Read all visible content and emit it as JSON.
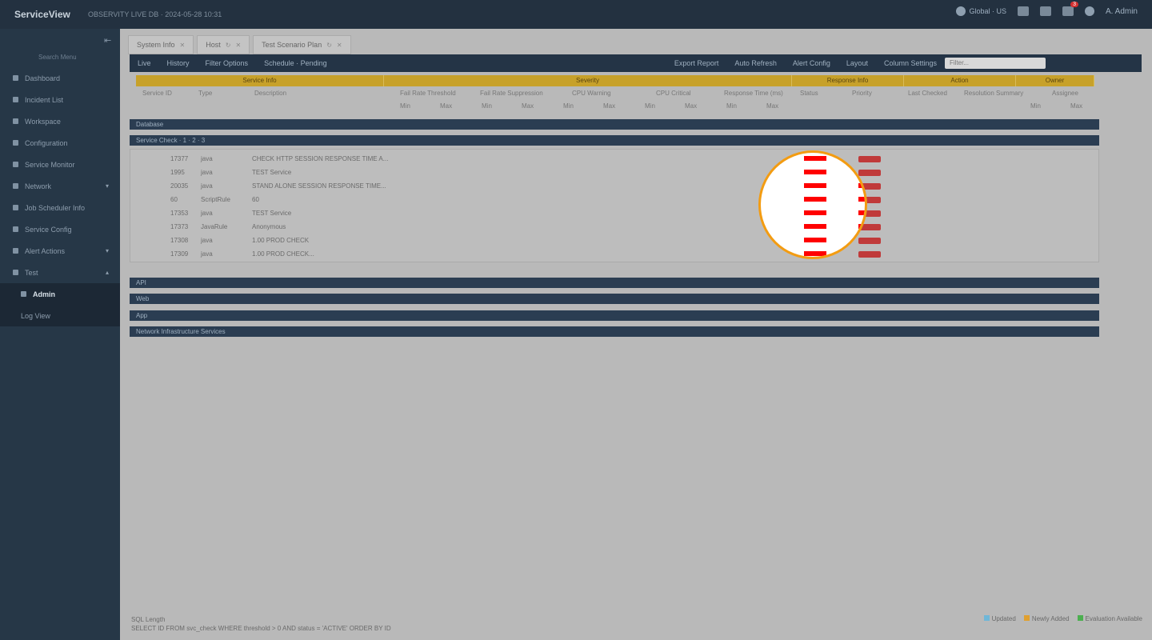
{
  "app": {
    "brand": "ServiceView",
    "subtitle": "OBSERVITY LIVE DB · 2024-05-28 10:31"
  },
  "topbar": {
    "region": "Global · US",
    "notifications": "3",
    "user": "A. Admin"
  },
  "sidebar": {
    "search_label": "Search Menu",
    "items": [
      "Dashboard",
      "Incident List",
      "Workspace",
      "Configuration",
      "Service Monitor",
      "Network",
      "Job Scheduler Info",
      "Service Config",
      "Alert Actions",
      "Test"
    ],
    "sub_items": [
      "Admin",
      "Log View"
    ]
  },
  "tabs": [
    "System Info",
    "Host",
    "Test Scenario Plan"
  ],
  "toolbar": {
    "left": [
      "Live",
      "History",
      "Filter Options",
      "Schedule · Pending"
    ],
    "right": [
      "Export Report",
      "Auto Refresh",
      "Alert Config",
      "Layout",
      "Column Settings"
    ],
    "search_placeholder": "Filter..."
  },
  "group_headers": [
    "Service Info",
    "Severity",
    "Response Info",
    "Action",
    "Owner"
  ],
  "sub_columns": [
    "Service ID",
    "Type",
    "Description",
    "Fail Rate Threshold",
    "Fail Rate Suppression",
    "CPU Warning",
    "CPU Critical",
    "Response Time (ms)",
    "Status",
    "Priority",
    "Last Checked",
    "Resolution Summary",
    "Assignee"
  ],
  "sub_sub_labels": [
    "Min",
    "Max",
    "Min",
    "Max",
    "Min",
    "Max",
    "Min",
    "Max",
    "Min",
    "Max",
    "Min",
    "Max"
  ],
  "sections": {
    "collapsed_top": "Database",
    "expanded": "Service Check · 1 · 2 · 3",
    "collapsed_bottom": [
      "API",
      "Web",
      "App",
      "Network Infrastructure Services"
    ]
  },
  "rows": [
    {
      "id": "17377",
      "type": "java",
      "desc": "CHECK HTTP SESSION RESPONSE TIME A..."
    },
    {
      "id": "1995",
      "type": "java",
      "desc": "TEST Service"
    },
    {
      "id": "20035",
      "type": "java",
      "desc": "STAND ALONE SESSION RESPONSE TIME..."
    },
    {
      "id": "60",
      "type": "ScriptRule",
      "desc": "60"
    },
    {
      "id": "17353",
      "type": "java",
      "desc": "TEST Service"
    },
    {
      "id": "17373",
      "type": "JavaRule",
      "desc": "Anonymous"
    },
    {
      "id": "17308",
      "type": "java",
      "desc": "1.00 PROD CHECK"
    },
    {
      "id": "17309",
      "type": "java",
      "desc": "1.00 PROD CHECK..."
    }
  ],
  "footer": {
    "title": "SQL Length",
    "query": "SELECT ID FROM svc_check WHERE threshold > 0 AND status = 'ACTIVE' ORDER BY ID"
  },
  "legend": [
    {
      "label": "Updated",
      "color": "#6fb7d8"
    },
    {
      "label": "Newly Added",
      "color": "#e0a030"
    },
    {
      "label": "Evaluation Available",
      "color": "#4caf50"
    }
  ],
  "colors": {
    "topbar": "#233140",
    "sidebar": "#263747",
    "header_gold": "#c7a12a",
    "section_bar": "#2b3d52",
    "highlight_ring": "#f39c12",
    "dash_red": "#ff0000"
  }
}
